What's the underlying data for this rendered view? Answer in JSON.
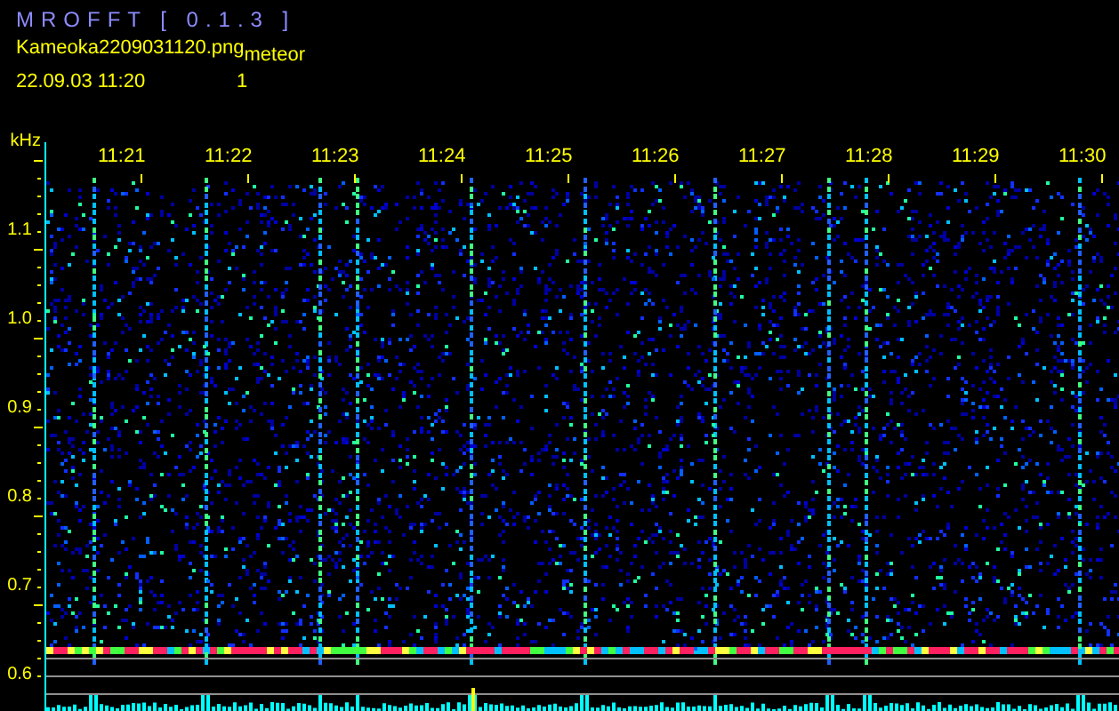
{
  "header": {
    "title": "MROFFT [ 0.1.3 ]",
    "filename": "Kameoka2209031120.png",
    "date_time": "22.09.03 11:20",
    "count_label": "meteor",
    "count": "1"
  },
  "frequency_axis": {
    "unit": "kHz",
    "labels": [
      "1.1",
      "1.0",
      "0.9",
      "0.8",
      "0.7",
      "0.6"
    ]
  },
  "time_axis": {
    "labels": [
      "11:21",
      "11:22",
      "11:23",
      "11:24",
      "11:25",
      "11:26",
      "11:27",
      "11:28",
      "11:29",
      "11:30"
    ]
  }
}
